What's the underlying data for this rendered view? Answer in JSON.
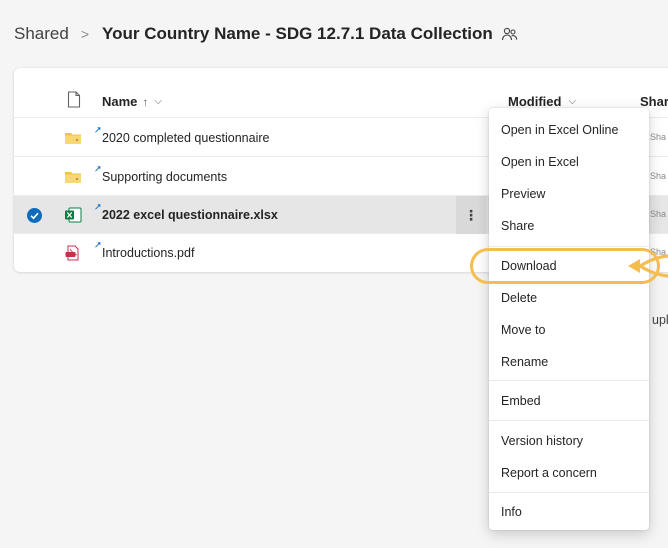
{
  "breadcrumb": {
    "root": "Shared",
    "separator": ">",
    "current": "Your Country Name - SDG 12.7.1 Data Collection",
    "current_icon": "people-shared-icon"
  },
  "columns": {
    "name": "Name",
    "name_sort_indicator": "↑",
    "name_chevron": "⌵",
    "modified": "Modified",
    "modified_chevron": "⌵",
    "sharing": "Shari"
  },
  "files": [
    {
      "name": "2020 completed questionnaire",
      "type": "folder",
      "icon": "folder-icon",
      "sharing": "Sha",
      "selected": false
    },
    {
      "name": "Supporting documents",
      "type": "folder",
      "icon": "folder-icon",
      "sharing": "Sha",
      "selected": false
    },
    {
      "name": "2022 excel questionnaire.xlsx",
      "type": "excel",
      "icon": "excel-file-icon",
      "sharing": "Sha",
      "selected": true
    },
    {
      "name": "Introductions.pdf",
      "type": "pdf",
      "icon": "pdf-file-icon",
      "sharing": "Sha",
      "selected": false
    }
  ],
  "more_actions_label": "⋮",
  "side_partial_text": "upl",
  "context_menu": {
    "items": [
      "Open in Excel Online",
      "Open in Excel",
      "Preview",
      "Share",
      "Download",
      "Delete",
      "Move to",
      "Rename",
      "Embed",
      "Version history",
      "Report a concern",
      "Info"
    ],
    "highlighted": "Download"
  },
  "colors": {
    "accent": "#0f6cbd",
    "highlight_ring": "#f5bd4f",
    "folder": "#f2c14e",
    "excel": "#107c41",
    "pdf": "#c4314b",
    "selected_row": "#e6e6e6"
  }
}
